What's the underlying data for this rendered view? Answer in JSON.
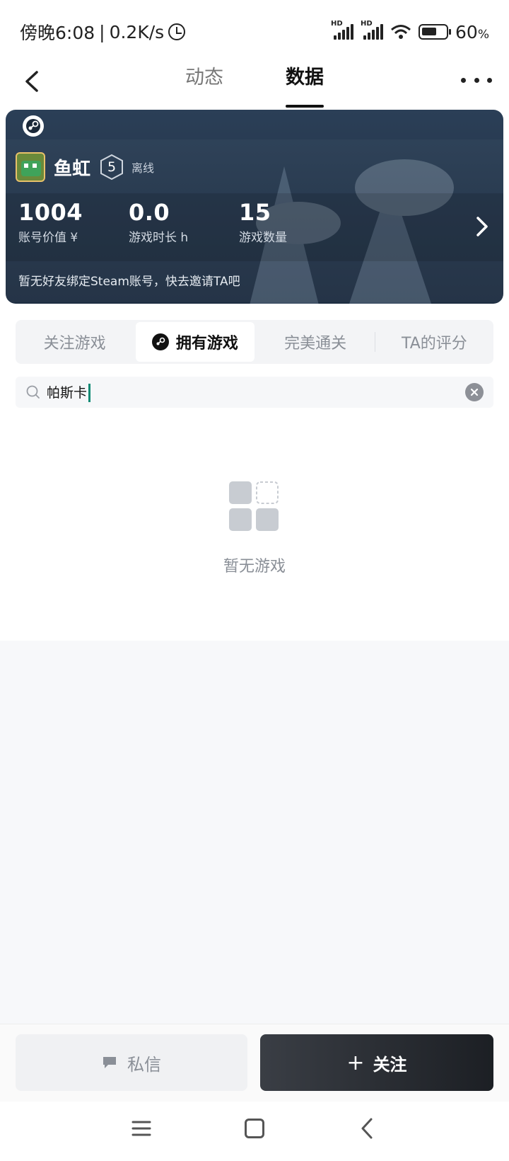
{
  "status_bar": {
    "time": "傍晚6:08",
    "separator": "|",
    "net_speed": "0.2K/s",
    "signal1_label": "HD",
    "signal2_label": "HD",
    "battery": "60",
    "battery_unit": "%"
  },
  "header": {
    "tabs": [
      {
        "label": "动态",
        "active": false
      },
      {
        "label": "数据",
        "active": true
      }
    ]
  },
  "profile_card": {
    "username": "鱼虹",
    "level": "5",
    "online_status": "离线",
    "stats": [
      {
        "value": "1004",
        "label": "账号价值 ¥"
      },
      {
        "value": "0.0",
        "label": "游戏时长 h"
      },
      {
        "value": "15",
        "label": "游戏数量"
      }
    ],
    "tip": "暂无好友绑定Steam账号，快去邀请TA吧"
  },
  "segment_tabs": [
    {
      "label": "关注游戏",
      "active": false
    },
    {
      "label": "拥有游戏",
      "active": true
    },
    {
      "label": "完美通关",
      "active": false
    },
    {
      "label": "TA的评分",
      "active": false
    }
  ],
  "search": {
    "value": "帕斯卡"
  },
  "empty_state": {
    "text": "暂无游戏"
  },
  "actions": {
    "message_label": "私信",
    "follow_plus": "+",
    "follow_label": "关注"
  },
  "colors": {
    "card_bg": "#24364c",
    "accent_caret": "#0e8a74",
    "follow_btn": "#1c1f24"
  }
}
